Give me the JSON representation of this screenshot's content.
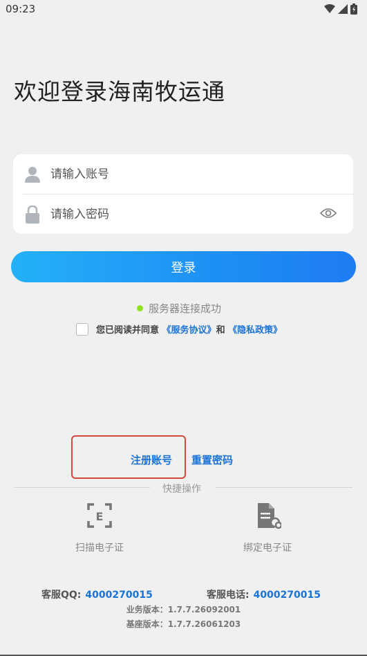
{
  "status_bar": {
    "time": "09:23"
  },
  "title": "欢迎登录海南牧运通",
  "login_form": {
    "account_placeholder": "请输入账号",
    "password_placeholder": "请输入密码",
    "login_label": "登录"
  },
  "connection_status": "服务器连接成功",
  "agreement": {
    "prefix": "您已阅读并同意",
    "service_link": "《服务协议》",
    "and": "和",
    "privacy_link": "《隐私政策》"
  },
  "links": {
    "register": "注册账号",
    "reset_password": "重置密码"
  },
  "quick_actions": {
    "label": "快捷操作",
    "scan": "扫描电子证",
    "bind": "绑定电子证"
  },
  "contact": {
    "qq_label": "客服QQ:",
    "qq_number": "4000270015",
    "phone_label": "客服电话:",
    "phone_number": "4000270015"
  },
  "versions": {
    "business": "业务版本：1.7.7.26092001",
    "base": "基座版本：1.7.7.26061203"
  },
  "colors": {
    "accent": "#1a73d9",
    "button_gradient_start": "#23b1f7",
    "button_gradient_end": "#1f7cf3",
    "status_ok": "#8fe21e",
    "highlight_box": "#d7483c"
  }
}
